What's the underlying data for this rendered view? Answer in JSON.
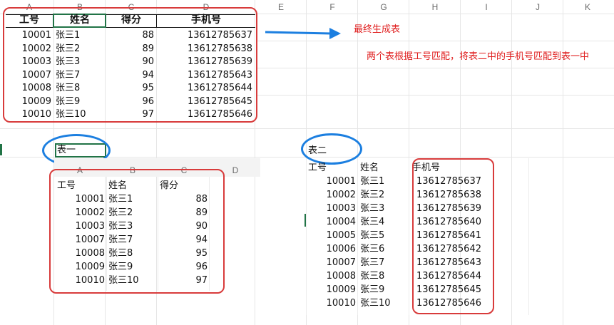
{
  "top_columns": [
    "A",
    "B",
    "C",
    "D",
    "E",
    "F",
    "G",
    "H",
    "I",
    "J",
    "K"
  ],
  "final_table": {
    "headers": [
      "工号",
      "姓名",
      "得分",
      "手机号"
    ],
    "rows": [
      [
        "10001",
        "张三1",
        "88",
        "13612785637"
      ],
      [
        "10002",
        "张三2",
        "89",
        "13612785638"
      ],
      [
        "10003",
        "张三3",
        "90",
        "13612785639"
      ],
      [
        "10007",
        "张三7",
        "94",
        "13612785643"
      ],
      [
        "10008",
        "张三8",
        "95",
        "13612785644"
      ],
      [
        "10009",
        "张三9",
        "96",
        "13612785645"
      ],
      [
        "10010",
        "张三10",
        "97",
        "13612785646"
      ]
    ]
  },
  "annotations": {
    "final_label": "最终生成表",
    "instruction": "两个表根据工号匹配，将表二中的手机号匹配到表一中",
    "table1_label": "表一",
    "table2_label": "表二"
  },
  "table1": {
    "columns": [
      "A",
      "B",
      "C",
      "D"
    ],
    "headers": [
      "工号",
      "姓名",
      "得分"
    ],
    "rows": [
      [
        "10001",
        "张三1",
        "88"
      ],
      [
        "10002",
        "张三2",
        "89"
      ],
      [
        "10003",
        "张三3",
        "90"
      ],
      [
        "10007",
        "张三7",
        "94"
      ],
      [
        "10008",
        "张三8",
        "95"
      ],
      [
        "10009",
        "张三9",
        "96"
      ],
      [
        "10010",
        "张三10",
        "97"
      ]
    ]
  },
  "table2": {
    "headers": [
      "工号",
      "姓名",
      "手机号"
    ],
    "rows": [
      [
        "10001",
        "张三1",
        "13612785637"
      ],
      [
        "10002",
        "张三2",
        "13612785638"
      ],
      [
        "10003",
        "张三3",
        "13612785639"
      ],
      [
        "10004",
        "张三4",
        "13612785640"
      ],
      [
        "10005",
        "张三5",
        "13612785641"
      ],
      [
        "10006",
        "张三6",
        "13612785642"
      ],
      [
        "10007",
        "张三7",
        "13612785643"
      ],
      [
        "10008",
        "张三8",
        "13612785644"
      ],
      [
        "10009",
        "张三9",
        "13612785645"
      ],
      [
        "10010",
        "张三10",
        "13612785646"
      ]
    ]
  },
  "colors": {
    "red": "#d83b3b",
    "blue": "#1c7fe0",
    "excel_green": "#217346"
  }
}
